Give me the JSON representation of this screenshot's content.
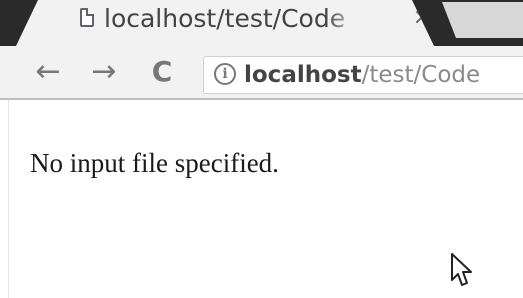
{
  "tab": {
    "title": "localhost/test/Code",
    "close_glyph": "×"
  },
  "toolbar": {
    "back_glyph": "←",
    "forward_glyph": "→",
    "reload_glyph": "C",
    "info_glyph": "i",
    "url_host": "localhost",
    "url_path": "/test/Code"
  },
  "page": {
    "message": "No input file specified."
  },
  "icons": {
    "tab": "file-icon",
    "close": "close-icon",
    "back": "arrow-left-icon",
    "forward": "arrow-right-icon",
    "reload": "reload-icon",
    "info": "info-icon",
    "cursor": "mouse-cursor-icon"
  },
  "colors": {
    "tab_strip": "#2a2a2a",
    "active_tab": "#f2f2f2",
    "toolbar": "#f2f2f2",
    "text": "#444444",
    "url_path": "#8a8a8a"
  }
}
